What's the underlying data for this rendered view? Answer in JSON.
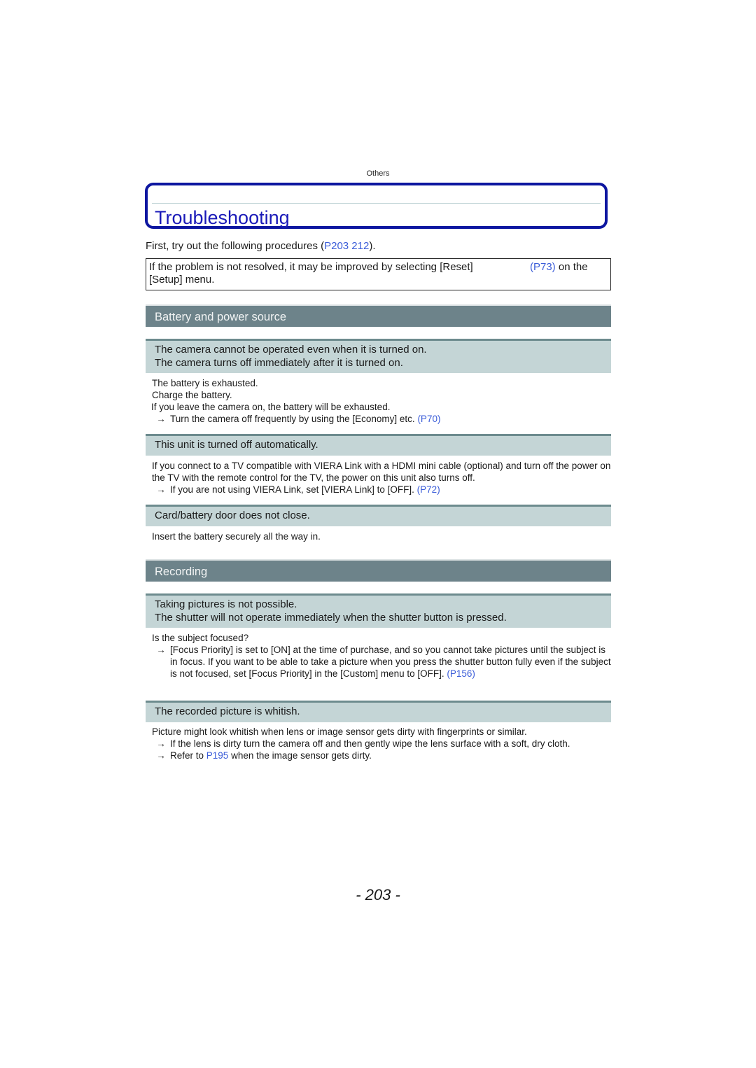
{
  "header": {
    "section": "Others"
  },
  "title": "Troubleshooting",
  "intro": {
    "text": "First, try out the following procedures (",
    "link": "P203  212",
    "end": ")."
  },
  "note": {
    "line1": "If the problem is not resolved, it may be improved by selecting [Reset]",
    "link": "(P73)",
    "after_link": " on the",
    "line2": "[Setup] menu."
  },
  "categories": [
    {
      "title": "Battery and power source",
      "items": [
        {
          "question": [
            "The camera cannot be operated even when it is turned on.",
            "The camera turns off immediately after it is turned on."
          ],
          "answer_lines": [
            "The battery is exhausted.",
            "Charge the battery.",
            "If you leave the camera on, the battery will be exhausted."
          ],
          "arrow_lines": [
            {
              "text": "Turn the camera off frequently by using the [Economy] etc. ",
              "link": "(P70)"
            }
          ]
        },
        {
          "question": [
            "This unit is turned off automatically."
          ],
          "answer_lines": [
            "If you connect to a TV compatible with VIERA Link with a HDMI mini cable (optional) and turn off the power on the TV with the remote control for the TV, the power on this unit also turns off."
          ],
          "arrow_lines": [
            {
              "text": "If you are not using VIERA Link, set [VIERA Link] to [OFF]. ",
              "link": "(P72)"
            }
          ]
        },
        {
          "question": [
            "Card/battery door does not close."
          ],
          "answer_lines": [
            "Insert the battery securely all the way in."
          ],
          "arrow_lines": []
        }
      ]
    },
    {
      "title": "Recording",
      "items": [
        {
          "question": [
            "Taking pictures is not possible.",
            "The shutter will not operate immediately when the shutter button is pressed."
          ],
          "answer_lines": [
            "Is the subject focused?"
          ],
          "arrow_lines": [
            {
              "text": "[Focus Priority] is set to [ON] at the time of purchase, and so you cannot take pictures until the subject is in focus. If you want to be able to take a picture when you press the shutter button fully even if the subject is not focused, set [Focus Priority] in the [Custom] menu to [OFF]. ",
              "link": "(P156)"
            }
          ]
        },
        {
          "question": [
            "The recorded picture is whitish."
          ],
          "answer_lines": [
            "Picture might look whitish when lens or image sensor gets dirty with fingerprints or similar."
          ],
          "arrow_lines": [
            {
              "text": "If the lens is dirty turn the camera off and then gently wipe the lens surface with a soft, dry cloth.",
              "link": ""
            },
            {
              "pre": "Refer to ",
              "link": "P195",
              "text": " when the image sensor gets dirty."
            }
          ]
        }
      ]
    }
  ],
  "arrow_glyph": "→",
  "page_number": "- 203 -",
  "colors": {
    "title_blue": "#0d16a0",
    "link_blue": "#3a5cd8",
    "category_bg": "#6d838a",
    "question_bg": "#c4d5d6"
  }
}
